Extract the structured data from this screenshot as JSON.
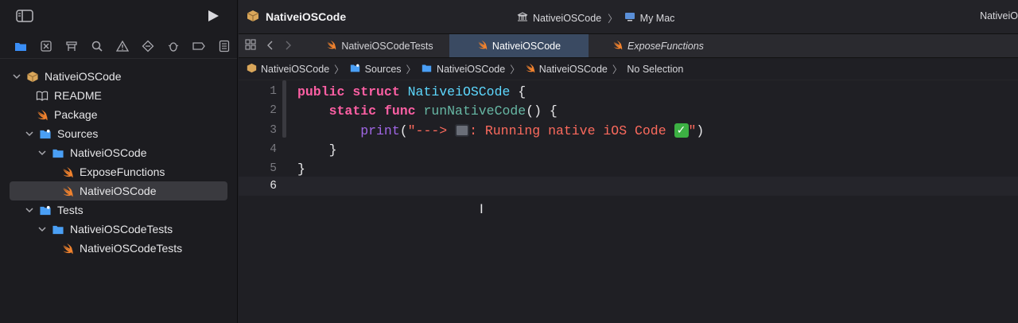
{
  "window": {
    "project_title": "NativeiOSCode",
    "scheme": "NativeiOSCode",
    "destination": "My Mac",
    "right_status": "NativeiO"
  },
  "colors": {
    "accent_blue": "#3a8ef6",
    "swift_orange": "#f0822e",
    "folder_blue": "#4a9ff5",
    "active_tab": "#3a4a62"
  },
  "navigator": {
    "icons": [
      "folder-icon",
      "source-control-icon",
      "symbol-icon",
      "search-icon",
      "warning-icon",
      "test-icon",
      "debug-icon",
      "breakpoint-icon",
      "report-icon"
    ]
  },
  "tree": [
    {
      "label": "NativeiOSCode",
      "icon": "package-icon",
      "level": 0,
      "disclosure": true
    },
    {
      "label": "README",
      "icon": "book-icon",
      "level": 1,
      "disclosure": false
    },
    {
      "label": "Package",
      "icon": "swift-icon",
      "level": 1,
      "disclosure": false
    },
    {
      "label": "Sources",
      "icon": "folder-icon",
      "level": 1,
      "disclosure": true
    },
    {
      "label": "NativeiOSCode",
      "icon": "folder-icon",
      "level": 2,
      "disclosure": true
    },
    {
      "label": "ExposeFunctions",
      "icon": "swift-icon",
      "level": 3,
      "disclosure": false
    },
    {
      "label": "NativeiOSCode",
      "icon": "swift-icon",
      "level": 3,
      "disclosure": false,
      "selected": true
    },
    {
      "label": "Tests",
      "icon": "folder-icon",
      "level": 1,
      "disclosure": true
    },
    {
      "label": "NativeiOSCodeTests",
      "icon": "folder-icon",
      "level": 2,
      "disclosure": true
    },
    {
      "label": "NativeiOSCodeTests",
      "icon": "swift-icon",
      "level": 3,
      "disclosure": false
    }
  ],
  "tabs": [
    {
      "label": "NativeiOSCodeTests",
      "active": false,
      "italic": false
    },
    {
      "label": "NativeiOSCode",
      "active": true,
      "italic": false
    },
    {
      "label": "ExposeFunctions",
      "active": false,
      "italic": true
    }
  ],
  "breadcrumbs": [
    "NativeiOSCode",
    "Sources",
    "NativeiOSCode",
    "NativeiOSCode",
    "No Selection"
  ],
  "code": {
    "line_numbers": [
      "1",
      "2",
      "3",
      "4",
      "5",
      "6"
    ],
    "l1_kw1": "public",
    "l1_kw2": "struct",
    "l1_type": "NativeiOSCode",
    "l1_rest": " {",
    "l2_kw1": "static",
    "l2_kw2": "func",
    "l2_fn": "runNativeCode",
    "l2_rest": "() {",
    "l3_fn": "print",
    "l3_open": "(",
    "l3_str_a": "\"---> ",
    "l3_str_b": ": Running native iOS Code ",
    "l3_str_c": "\"",
    "l3_close": ")",
    "l4": "}",
    "l5": "}"
  }
}
